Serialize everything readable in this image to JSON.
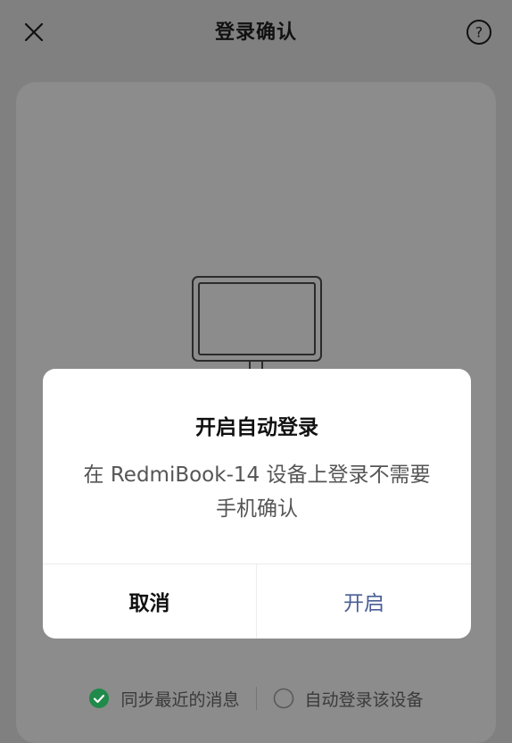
{
  "header": {
    "title": "登录确认",
    "close_icon": "close-icon",
    "help_icon": "help-icon"
  },
  "options": [
    {
      "label": "同步最近的消息",
      "checked": true
    },
    {
      "label": "自动登录该设备",
      "checked": false
    }
  ],
  "dialog": {
    "title": "开启自动登录",
    "message_line1": "在 RedmiBook-14 设备上登录不需要",
    "message_line2": "手机确认",
    "cancel_label": "取消",
    "confirm_label": "开启"
  },
  "colors": {
    "accent_blue": "#4a5f95",
    "check_green": "#1f8a49",
    "overlay": "#808080"
  }
}
